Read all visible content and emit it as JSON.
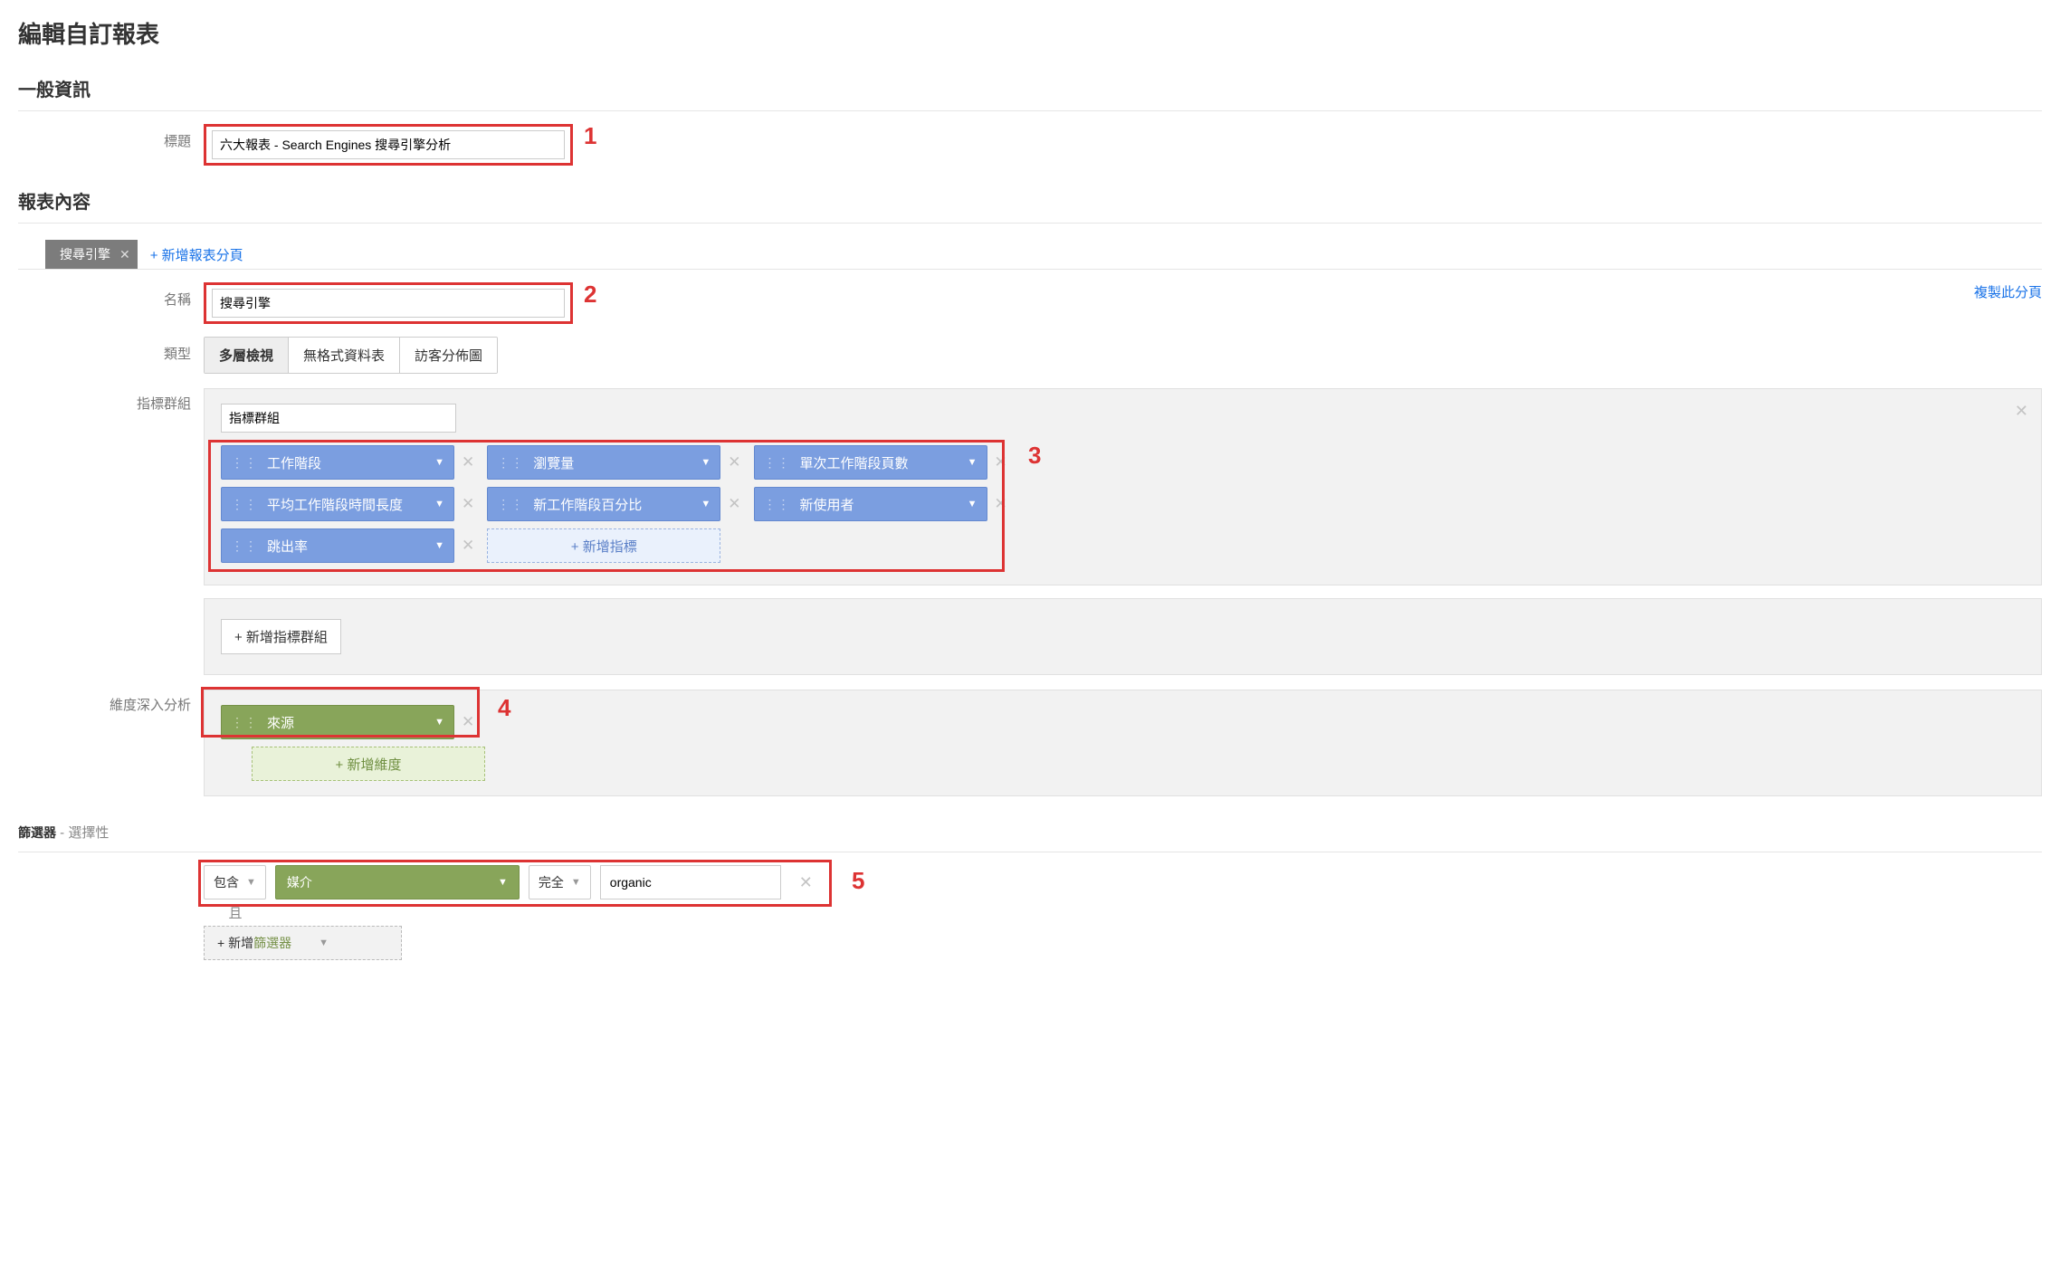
{
  "page_title": "編輯自訂報表",
  "sections": {
    "general": {
      "header": "一般資訊",
      "title_label": "標題",
      "title_value": "六大報表 - Search Engines 搜尋引擎分析"
    },
    "content": {
      "header": "報表內容",
      "tab_name": "搜尋引擎",
      "add_tab": "+ 新增報表分頁",
      "name_label": "名稱",
      "name_value": "搜尋引擎",
      "copy_link": "複製此分頁",
      "type_label": "類型",
      "type_buttons": [
        "多層檢視",
        "無格式資料表",
        "訪客分佈圖"
      ],
      "metric_group_label": "指標群組",
      "metric_group_input": "指標群組",
      "metrics": [
        "工作階段",
        "瀏覽量",
        "單次工作階段頁數",
        "平均工作階段時間長度",
        "新工作階段百分比",
        "新使用者",
        "跳出率"
      ],
      "add_metric": "+ 新增指標",
      "add_metric_group": "+ 新增指標群組",
      "dim_label": "維度深入分析",
      "dimension": "來源",
      "add_dim": "+ 新增維度"
    },
    "filter": {
      "header": "篩選器",
      "header_sub": " - 選擇性",
      "include": "包含",
      "dimension": "媒介",
      "match": "完全",
      "value": "organic",
      "and": "且",
      "add_filter_pre": "+ 新增",
      "add_filter_grn": "篩選器"
    }
  },
  "annotations": {
    "n1": "1",
    "n2": "2",
    "n3": "3",
    "n4": "4",
    "n5": "5"
  }
}
